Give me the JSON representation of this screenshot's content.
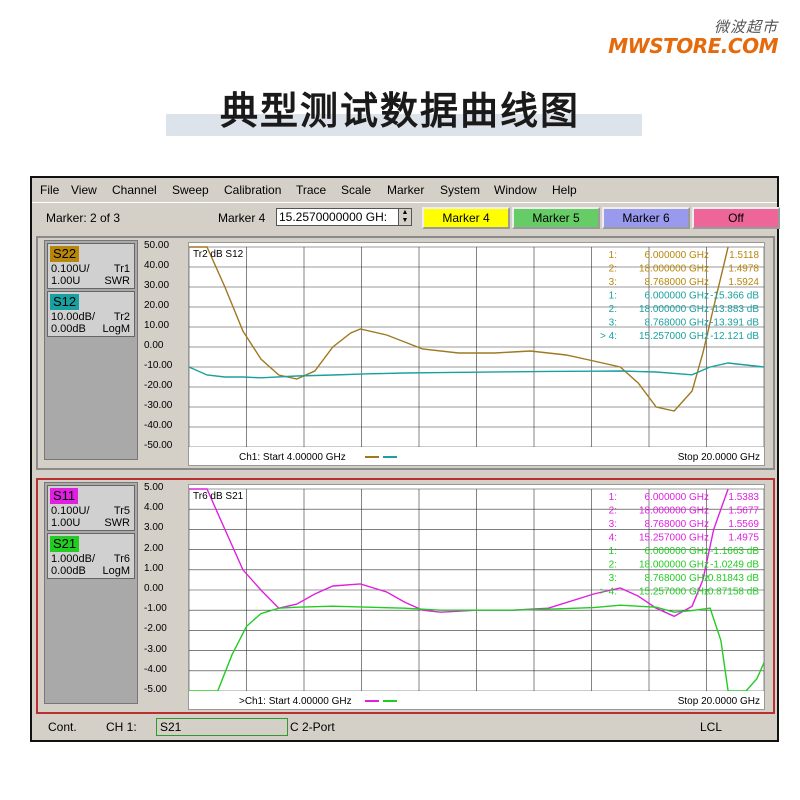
{
  "brand": {
    "cn": "微波超市",
    "en": "MWSTORE.COM",
    "accent": "#e46a0c"
  },
  "headline": "典型测试数据曲线图",
  "menu": [
    "File",
    "View",
    "Channel",
    "Sweep",
    "Calibration",
    "Trace",
    "Scale",
    "Marker",
    "System",
    "Window",
    "Help"
  ],
  "toolbar": {
    "marker_count": "Marker: 2 of 3",
    "marker_label": "Marker 4",
    "marker_value": "15.2570000000 GH:",
    "buttons": [
      {
        "label": "Marker 4",
        "color": "#ffff00"
      },
      {
        "label": "Marker 5",
        "color": "#66cc66"
      },
      {
        "label": "Marker 6",
        "color": "#9999ee"
      },
      {
        "label": "Off",
        "color": "#ee6699"
      }
    ]
  },
  "panels": [
    {
      "traces": [
        {
          "name": "S22",
          "color": "#b8860b",
          "scale": "0.100U/",
          "ref": "1.00U",
          "tr": "Tr1",
          "fmt": "SWR"
        },
        {
          "name": "S12",
          "color": "#19a0a0",
          "scale": "10.00dB/",
          "ref": "0.00dB",
          "tr": "Tr2",
          "fmt": "LogM"
        }
      ],
      "yticks": [
        "50.00",
        "40.00",
        "30.00",
        "20.00",
        "10.00",
        "0.00",
        "-10.00",
        "-20.00",
        "-30.00",
        "-40.00",
        "-50.00"
      ],
      "active_title": "Tr2 dB S12",
      "marker_rows": [
        {
          "n": "1:",
          "f": "6.000000 GHz",
          "v": "1.5118",
          "c": "#b8860b"
        },
        {
          "n": "2:",
          "f": "18.000000 GHz",
          "v": "1.4978",
          "c": "#b8860b"
        },
        {
          "n": "3:",
          "f": "8.768000 GHz",
          "v": "1.5924",
          "c": "#b8860b"
        },
        {
          "n": "1:",
          "f": "6.000000 GHz",
          "v": "-15.366 dB",
          "c": "#19a0a0"
        },
        {
          "n": "2:",
          "f": "18.000000 GHz",
          "v": "-13.883 dB",
          "c": "#19a0a0"
        },
        {
          "n": "3:",
          "f": "8.768000 GHz",
          "v": "-13.391 dB",
          "c": "#19a0a0"
        },
        {
          "n": "> 4:",
          "f": "15.257000 GHz",
          "v": "-12.121 dB",
          "c": "#19a0a0"
        }
      ],
      "start": "Ch1: Start  4.00000 GHz",
      "stop": "Stop  20.0000 GHz"
    },
    {
      "traces": [
        {
          "name": "S11",
          "color": "#e020e0",
          "scale": "0.100U/",
          "ref": "1.00U",
          "tr": "Tr5",
          "fmt": "SWR"
        },
        {
          "name": "S21",
          "color": "#22cc22",
          "scale": "1.000dB/",
          "ref": "0.00dB",
          "tr": "Tr6",
          "fmt": "LogM"
        }
      ],
      "yticks": [
        "5.00",
        "4.00",
        "3.00",
        "2.00",
        "1.00",
        "0.00",
        "-1.00",
        "-2.00",
        "-3.00",
        "-4.00",
        "-5.00"
      ],
      "active_title": "Tr6 dB S21",
      "marker_rows": [
        {
          "n": "1:",
          "f": "6.000000 GHz",
          "v": "1.5383",
          "c": "#e020e0"
        },
        {
          "n": "2:",
          "f": "18.000000 GHz",
          "v": "1.5677",
          "c": "#e020e0"
        },
        {
          "n": "3:",
          "f": "8.768000 GHz",
          "v": "1.5569",
          "c": "#e020e0"
        },
        {
          "n": "4:",
          "f": "15.257000 GHz",
          "v": "1.4975",
          "c": "#e020e0"
        },
        {
          "n": "1:",
          "f": "6.000000 GHz",
          "v": "-1.1663 dB",
          "c": "#22cc22"
        },
        {
          "n": "2:",
          "f": "18.000000 GHz",
          "v": "-1.0249 dB",
          "c": "#22cc22"
        },
        {
          "n": "3:",
          "f": "8.768000 GHz",
          "v": "-0.81843 dB",
          "c": "#22cc22"
        },
        {
          "n": "> 4:",
          "f": "15.257000 GHz",
          "v": "-0.87158 dB",
          "c": "#22cc22"
        }
      ],
      "start": ">Ch1: Start  4.00000 GHz",
      "stop": "Stop  20.0000 GHz"
    }
  ],
  "chart_data": [
    {
      "type": "line",
      "xlim": [
        4,
        20
      ],
      "ylim": [
        -50,
        50
      ],
      "series": [
        {
          "name": "S22",
          "color": "#a07820",
          "x": [
            4.0,
            4.5,
            5.0,
            5.5,
            6.0,
            6.5,
            7.0,
            7.5,
            8.0,
            8.5,
            8.77,
            9.5,
            10.5,
            11.5,
            12.5,
            13.5,
            14.5,
            15.26,
            16.0,
            16.5,
            17.0,
            17.5,
            18.0,
            18.3,
            18.6,
            19.0
          ],
          "y": [
            50,
            50,
            30,
            8,
            -6,
            -14,
            -16,
            -12,
            0,
            7,
            9,
            6,
            -1,
            -3,
            -3,
            -2,
            -4,
            -7,
            -10,
            -18,
            -30,
            -32,
            -22,
            -3,
            20,
            50
          ]
        },
        {
          "name": "S12",
          "color": "#19a0a0",
          "x": [
            4.0,
            4.5,
            5.0,
            5.5,
            6.0,
            7.0,
            8.0,
            9.0,
            10.0,
            11.0,
            12.0,
            13.0,
            14.0,
            15.26,
            16.0,
            17.0,
            18.0,
            18.5,
            19.0,
            19.5,
            20.0
          ],
          "y": [
            -10,
            -14,
            -15,
            -15,
            -15.4,
            -14.5,
            -14,
            -13.4,
            -13,
            -12.8,
            -12.6,
            -12.4,
            -12.2,
            -12.1,
            -12,
            -12.5,
            -13.9,
            -10,
            -8,
            -9,
            -10
          ]
        }
      ]
    },
    {
      "type": "line",
      "xlim": [
        4,
        20
      ],
      "ylim": [
        -5,
        5
      ],
      "series": [
        {
          "name": "S11",
          "color": "#e020e0",
          "x": [
            4.0,
            4.5,
            5.0,
            5.5,
            6.0,
            6.5,
            7.0,
            7.5,
            8.0,
            8.77,
            9.5,
            10.0,
            10.5,
            11.0,
            12.0,
            13.0,
            14.0,
            15.26,
            16.0,
            16.5,
            17.0,
            17.5,
            18.0,
            18.3,
            18.6,
            19.0
          ],
          "y": [
            5,
            5,
            3,
            1,
            0,
            -0.9,
            -0.7,
            -0.2,
            0.2,
            0.3,
            -0.1,
            -0.6,
            -1.0,
            -1.1,
            -1.0,
            -1.0,
            -0.9,
            -0.2,
            0.1,
            -0.3,
            -0.9,
            -1.3,
            -0.8,
            0.5,
            3,
            5
          ]
        },
        {
          "name": "S21",
          "color": "#22cc22",
          "x": [
            4.0,
            4.8,
            5.2,
            5.6,
            6.0,
            6.5,
            7.0,
            8.0,
            9.0,
            10.0,
            11.0,
            12.0,
            13.0,
            14.0,
            15.26,
            16.0,
            17.0,
            17.5,
            18.0,
            18.5,
            18.8,
            19.0,
            19.5,
            19.8,
            20.0
          ],
          "y": [
            -5,
            -5,
            -3.2,
            -1.8,
            -1.17,
            -0.9,
            -0.85,
            -0.8,
            -0.85,
            -0.9,
            -1.0,
            -1.0,
            -1.0,
            -0.95,
            -0.87,
            -0.75,
            -0.85,
            -1.1,
            -1.02,
            -0.9,
            -2.5,
            -5,
            -5,
            -4.4,
            -3.6
          ]
        }
      ]
    }
  ],
  "status": {
    "mode": "Cont.",
    "channel": "CH 1:",
    "param": "S21",
    "cal": "C  2-Port",
    "lcl": "LCL"
  }
}
